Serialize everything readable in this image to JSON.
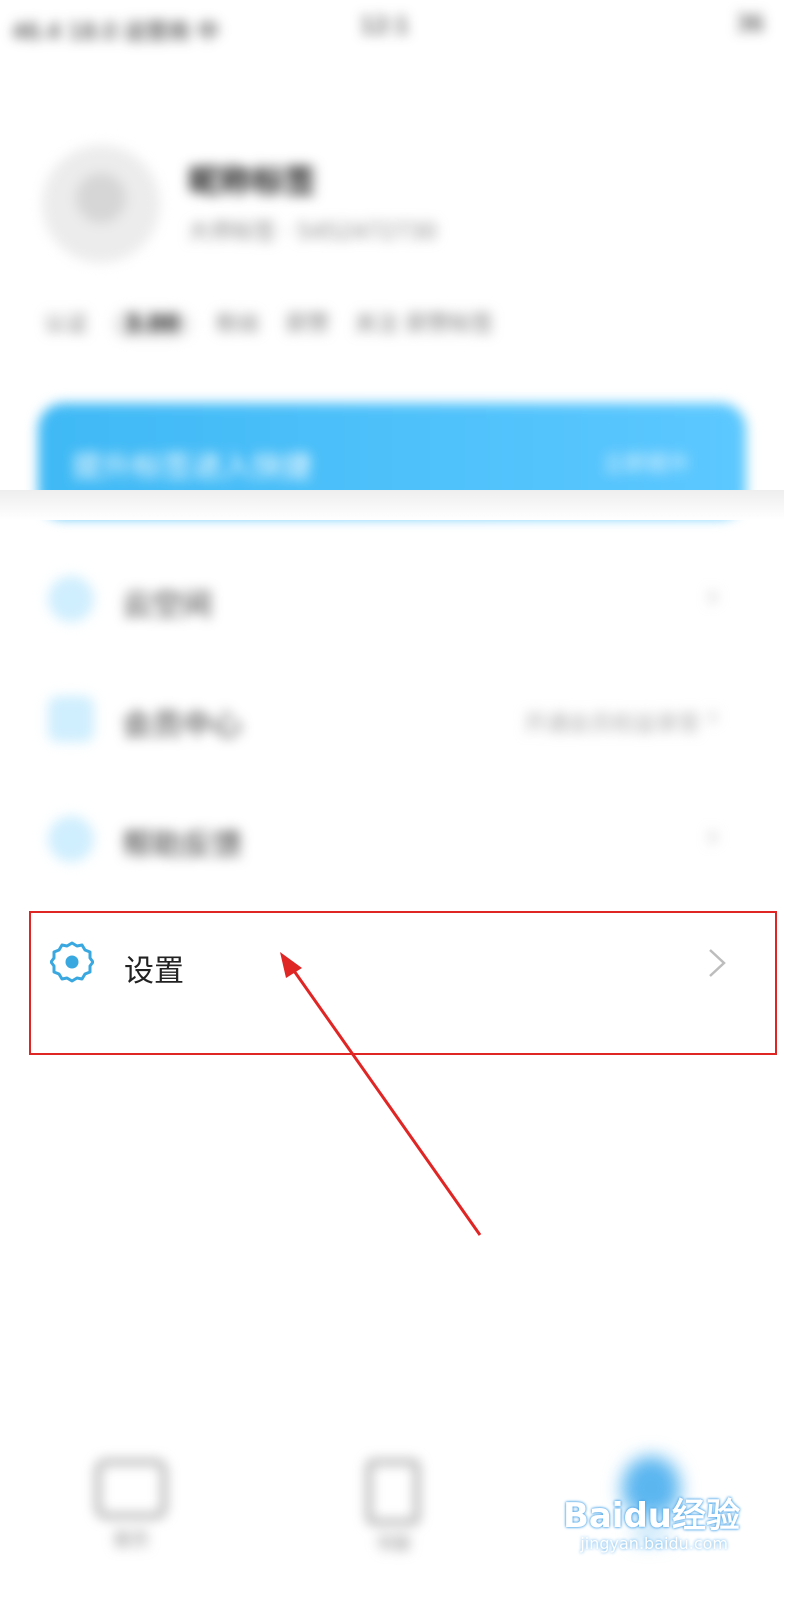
{
  "status_bar": {
    "left": "46.4 18.0 运营商 中",
    "mid": "12:1",
    "right": "36"
  },
  "profile": {
    "name": "昵称标签",
    "subtitle": "大师标签 · 5452472730",
    "stats": [
      "认证",
      "3.00",
      "粉丝",
      "获赞",
      "关注 获赞标签"
    ]
  },
  "banner": {
    "text": "提升标签进入快捷",
    "button": "立即提升"
  },
  "menu": {
    "items": [
      {
        "label": "云空间",
        "extra": ""
      },
      {
        "label": "会员中心",
        "extra": "开通会员权益享受"
      },
      {
        "label": "帮助反馈",
        "extra": ""
      }
    ],
    "settings_label": "设置"
  },
  "bottom_nav": {
    "items": [
      "首页",
      "书架",
      "我的"
    ]
  },
  "watermark": {
    "brand": "Baidu经验",
    "url": "jingyan.baidu.com"
  },
  "colors": {
    "accent": "#3fb9f5",
    "highlight": "#e02525",
    "icon": "#3aa8e0"
  }
}
